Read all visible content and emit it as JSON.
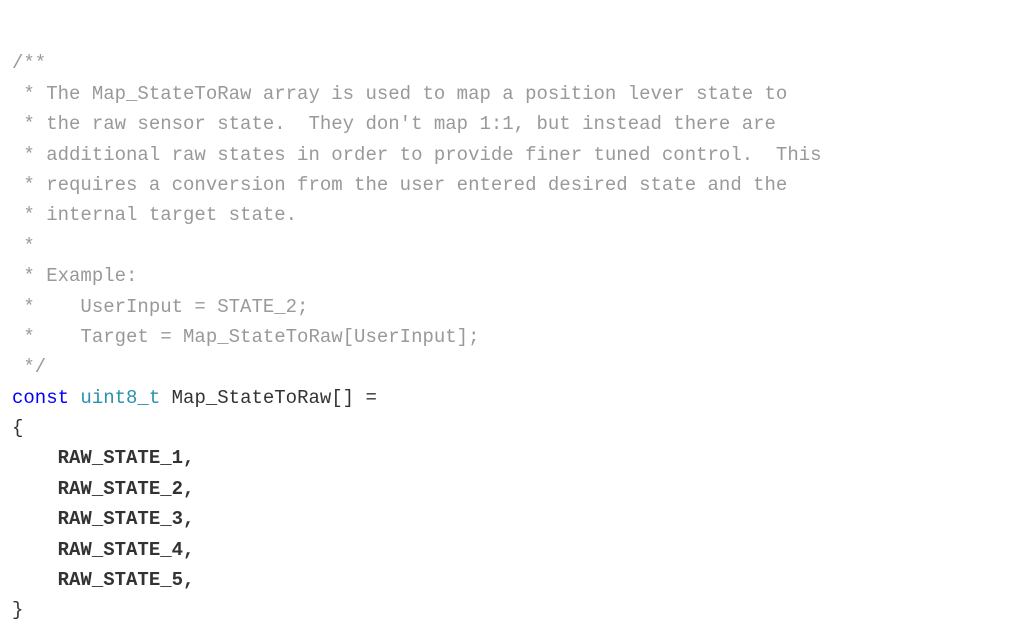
{
  "code": {
    "comment_open": "/**",
    "comment_line1": " * The Map_StateToRaw array is used to map a position lever state to",
    "comment_line2": " * the raw sensor state.  They don't map 1:1, but instead there are",
    "comment_line3": " * additional raw states in order to provide finer tuned control.  This",
    "comment_line4": " * requires a conversion from the user entered desired state and the",
    "comment_line5": " * internal target state.",
    "comment_blank": " *",
    "comment_example": " * Example:",
    "comment_ex1": " *    UserInput = STATE_2;",
    "comment_ex2": " *    Target = Map_StateToRaw[UserInput];",
    "comment_close": " */",
    "keyword_const": "const",
    "type_uint8": "uint8_t",
    "declaration": "Map_StateToRaw[] =",
    "brace_open": "{",
    "items": [
      "    RAW_STATE_1,",
      "    RAW_STATE_2,",
      "    RAW_STATE_3,",
      "    RAW_STATE_4,",
      "    RAW_STATE_5,"
    ],
    "brace_close": "}"
  }
}
